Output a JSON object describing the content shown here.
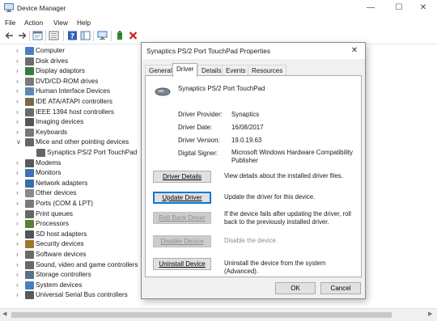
{
  "window": {
    "title": "Device Manager",
    "minimize": "—",
    "maximize": "☐",
    "close": "✕"
  },
  "menu": [
    "File",
    "Action",
    "View",
    "Help"
  ],
  "tree": [
    {
      "label": "Computer",
      "icon": "computer-icon",
      "color": "#4a7fbf",
      "expanded": false
    },
    {
      "label": "Disk drives",
      "icon": "disk-drive-icon",
      "color": "#6d6d6d",
      "expanded": false
    },
    {
      "label": "Display adaptors",
      "icon": "display-adapter-icon",
      "color": "#3d7a3d",
      "expanded": false
    },
    {
      "label": "DVD/CD-ROM drives",
      "icon": "dvd-drive-icon",
      "color": "#7a7a7a",
      "expanded": false
    },
    {
      "label": "Human Interface Devices",
      "icon": "hid-icon",
      "color": "#5f86b6",
      "expanded": false
    },
    {
      "label": "IDE ATA/ATAPI controllers",
      "icon": "ide-controller-icon",
      "color": "#7b6a4a",
      "expanded": false
    },
    {
      "label": "IEEE 1394 host controllers",
      "icon": "ieee1394-icon",
      "color": "#6a6a6a",
      "expanded": false
    },
    {
      "label": "Imaging devices",
      "icon": "camera-icon",
      "color": "#555555",
      "expanded": false
    },
    {
      "label": "Keyboards",
      "icon": "keyboard-icon",
      "color": "#777777",
      "expanded": false
    },
    {
      "label": "Mice and other pointing devices",
      "icon": "mouse-icon",
      "color": "#666666",
      "expanded": true
    },
    {
      "label": "Synaptics PS/2 Port TouchPad",
      "icon": "mouse-icon",
      "color": "#666666",
      "child": true
    },
    {
      "label": "Modems",
      "icon": "modem-icon",
      "color": "#5a5a5a",
      "expanded": false
    },
    {
      "label": "Monitors",
      "icon": "monitor-icon",
      "color": "#3f73b5",
      "expanded": false
    },
    {
      "label": "Network adapters",
      "icon": "network-adapter-icon",
      "color": "#3a6ea5",
      "expanded": false
    },
    {
      "label": "Other devices",
      "icon": "other-devices-icon",
      "color": "#8a8a8a",
      "expanded": false
    },
    {
      "label": "Ports (COM & LPT)",
      "icon": "port-icon",
      "color": "#7a7a7a",
      "expanded": false
    },
    {
      "label": "Print queues",
      "icon": "printer-icon",
      "color": "#666666",
      "expanded": false
    },
    {
      "label": "Processors",
      "icon": "processor-icon",
      "color": "#5c7f3a",
      "expanded": false
    },
    {
      "label": "SD host adapters",
      "icon": "sd-card-icon",
      "color": "#555555",
      "expanded": false
    },
    {
      "label": "Security devices",
      "icon": "security-icon",
      "color": "#9a7a2a",
      "expanded": false
    },
    {
      "label": "Software devices",
      "icon": "software-device-icon",
      "color": "#6a6a6a",
      "expanded": false
    },
    {
      "label": "Sound, video and game controllers",
      "icon": "speaker-icon",
      "color": "#6a6a6a",
      "expanded": false
    },
    {
      "label": "Storage controllers",
      "icon": "storage-controller-icon",
      "color": "#5a6f8a",
      "expanded": false
    },
    {
      "label": "System devices",
      "icon": "system-device-icon",
      "color": "#4a7fbf",
      "expanded": false
    },
    {
      "label": "Universal Serial Bus controllers",
      "icon": "usb-icon",
      "color": "#5a5a5a",
      "expanded": false
    }
  ],
  "dialog": {
    "title": "Synaptics PS/2 Port TouchPad Properties",
    "close": "✕",
    "tabs": [
      "General",
      "Driver",
      "Details",
      "Events",
      "Resources"
    ],
    "active_tab": "Driver",
    "device_name": "Synaptics PS/2 Port TouchPad",
    "provider_label": "Driver Provider:",
    "provider_value": "Synaptics",
    "date_label": "Driver Date:",
    "date_value": "16/08/2017",
    "version_label": "Driver Version:",
    "version_value": "19.0.19.63",
    "signer_label": "Digital Signer:",
    "signer_value": "Microsoft Windows Hardware Compatibility Publisher",
    "buttons": {
      "details": {
        "label": "Driver Details",
        "desc": "View details about the installed driver files."
      },
      "update": {
        "label": "Update Driver",
        "desc": "Update the driver for this device."
      },
      "rollback": {
        "label": "Roll Back Driver",
        "desc": "If the device fails after updating the driver, roll back to the previously installed driver."
      },
      "disable": {
        "label": "Disable Device",
        "desc": "Disable the device."
      },
      "uninstall": {
        "label": "Uninstall Device",
        "desc": "Uninstall the device from the system (Advanced)."
      }
    },
    "ok": "OK",
    "cancel": "Cancel"
  },
  "colors": {
    "accent": "#0078d7",
    "remove_red": "#d11a1a",
    "disabled_text": "#8e8e8e"
  }
}
